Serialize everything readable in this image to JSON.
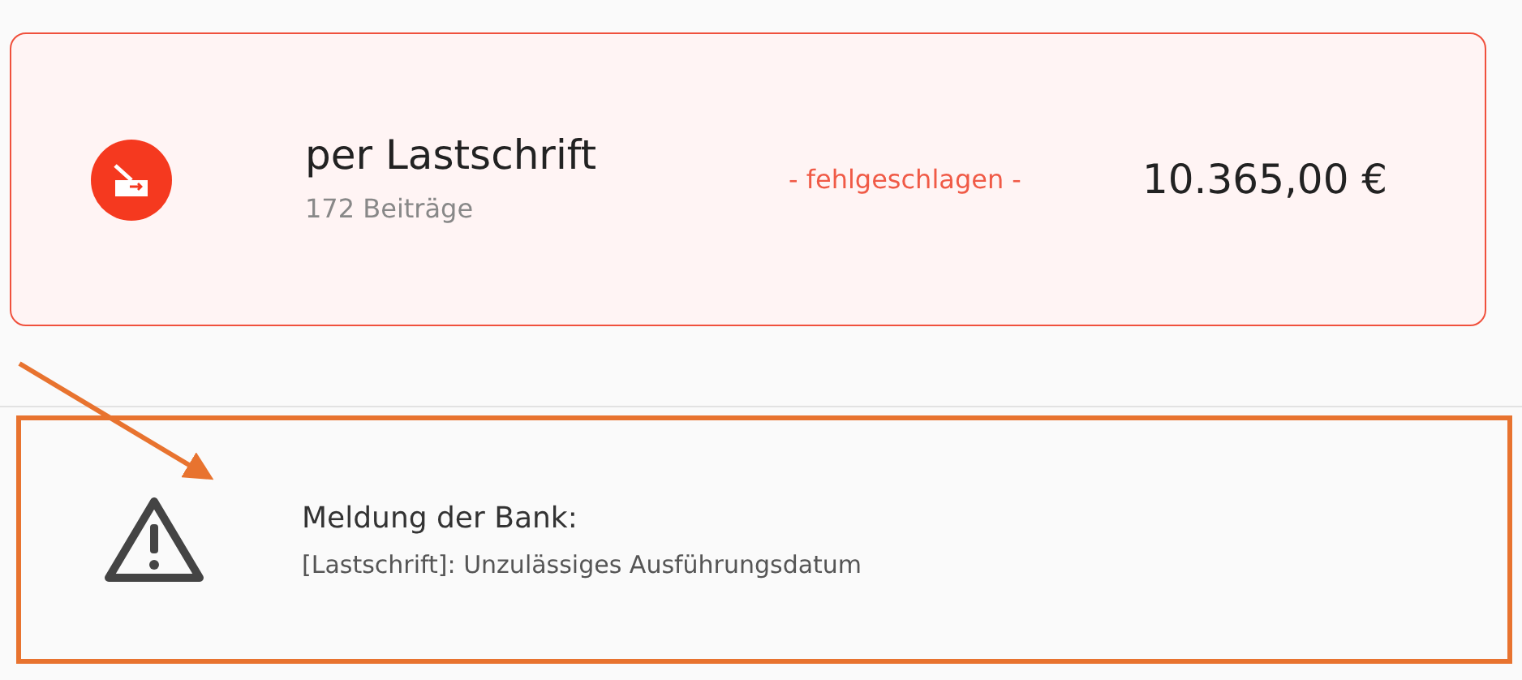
{
  "payment": {
    "failed": true,
    "title": "per Lastschrift",
    "count": "172 Beiträge",
    "status_text": "- fehlgeschlagen -",
    "amount": "10.365,00 €"
  },
  "bank_message": {
    "highlighted": true,
    "title": "Meldung der Bank:",
    "text": "[Lastschrift]: Unzulässiges Ausführungsdatum"
  }
}
